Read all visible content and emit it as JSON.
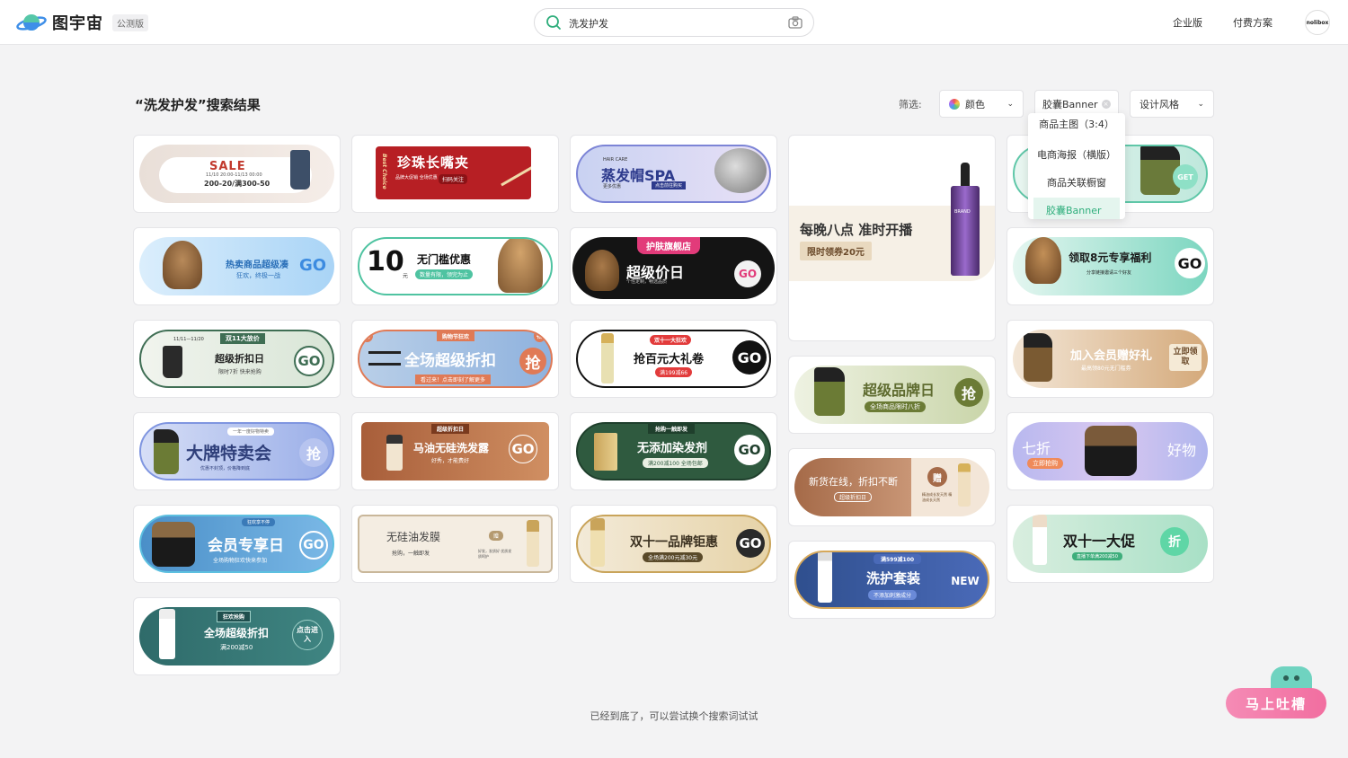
{
  "header": {
    "brand": "图宇宙",
    "beta_badge": "公测版",
    "search": {
      "value": "洗发护发",
      "icon": "search-icon",
      "camera_icon": "camera-icon"
    },
    "nav": {
      "enterprise": "企业版",
      "pricing": "付费方案"
    },
    "avatar_text": "nolibox"
  },
  "results": {
    "title": "“洗发护发”搜索结果",
    "filter_label": "筛选:",
    "filters": {
      "color": "颜色",
      "type": "胶囊Banner",
      "style": "设计风格"
    },
    "dropdown_options": [
      "商品主图（3:4）",
      "电商海报（横版）",
      "商品关联橱窗",
      "胶囊Banner"
    ],
    "dropdown_selected": "胶囊Banner"
  },
  "banners": {
    "b1": {
      "title": "SALE",
      "line1": "11/10 20:00-11/13 00:00",
      "line2": "200-20/满300-50"
    },
    "b2": {
      "title": "珍珠长嘴夹",
      "side": "Best Choice",
      "sub": "品牌大促销 全场优惠",
      "tag": "扫码关注"
    },
    "b3": {
      "kicker": "HAIR CARE",
      "title": "蒸发帽SPA",
      "sub": "更多优惠",
      "tag": "点击前往购买"
    },
    "b4": {
      "title": "每晚八点 准时开播",
      "tag": "限时领券20元",
      "brand": "BRAND"
    },
    "b5": {
      "tag": "GET"
    },
    "b6": {
      "title": "热卖商品超级凑",
      "sub": "狂欢，终极一战",
      "go": "GO"
    },
    "b7": {
      "num": "10",
      "unit": "元",
      "title": "无门槛优惠",
      "tag": "数量有限，领完为止"
    },
    "b8": {
      "top": "护肤旗舰店",
      "title": "超级价日",
      "sub": "个性定制，畅选品质",
      "go": "GO"
    },
    "b9": {
      "title": "领取8元专享福利",
      "sub": "分享链接邀请三个好友",
      "go": "GO"
    },
    "b10": {
      "date": "11/11—11/20",
      "top": "双11大放价",
      "title": "超级折扣日",
      "sub": "限时7折 快来抢购",
      "go": "GO"
    },
    "b11": {
      "top": "购物节狂欢",
      "title": "全场超级折扣",
      "sub": "看过来！点击即刻了解更多",
      "go": "抢",
      "badge1": "购",
      "badge2": "物"
    },
    "b12": {
      "top": "双十一大狂欢",
      "title": "抢百元大礼卷",
      "tag": "满199减66",
      "go": "GO"
    },
    "b13": {
      "title": "超级品牌日",
      "sub": "全场商品限时八折",
      "go": "抢"
    },
    "b14": {
      "title": "加入会员赠好礼",
      "sub": "最高领80元无门槛券",
      "go": "立即领取"
    },
    "b15": {
      "top": "一年一度好物特卖",
      "title": "大牌特卖会",
      "sub": "优惠不封顶，价格降到底",
      "go": "抢"
    },
    "b16": {
      "top": "超级折扣日",
      "title": "马油无硅洗发露",
      "sub": "好秀，才能费好",
      "go": "GO"
    },
    "b17": {
      "top": "抢购一触即发",
      "title": "无添加染发剂",
      "tag": "满200减100 全场包邮",
      "go": "GO"
    },
    "b18": {
      "title": "新货在线，折扣不断",
      "tag": "超级折扣日",
      "go": "赠",
      "sub": "精油成长发天然 精油成长天然"
    },
    "b19": {
      "left": "七折",
      "tag": "立即抢购",
      "right": "好物"
    },
    "b20": {
      "top": "狂欢享不停",
      "title": "会员专享日",
      "sub": "全场购物狂欢快来参加",
      "go": "GO"
    },
    "b21": {
      "title": "无硅油发膜",
      "sub": "抢购，一触即发",
      "badge": "赠",
      "side": "好发，发质好 优质发质呵护"
    },
    "b22": {
      "title": "双十一品牌钜惠",
      "tag": "全场满200元减30元",
      "go": "GO"
    },
    "b23": {
      "top": "满599减100",
      "title": "洗护套装",
      "sub": "不添加刺激成分",
      "go": "NEW"
    },
    "b24": {
      "title": "双十一大促",
      "sub": "直播下单满200减50",
      "go": "折"
    },
    "b25": {
      "top": "狂欢抢购",
      "title": "全场超级折扣",
      "sub": "满200减50",
      "go": "点击进入"
    }
  },
  "footer": {
    "note": "已经到底了，可以尝试换个搜索词试试",
    "feedback": "马上吐槽"
  }
}
